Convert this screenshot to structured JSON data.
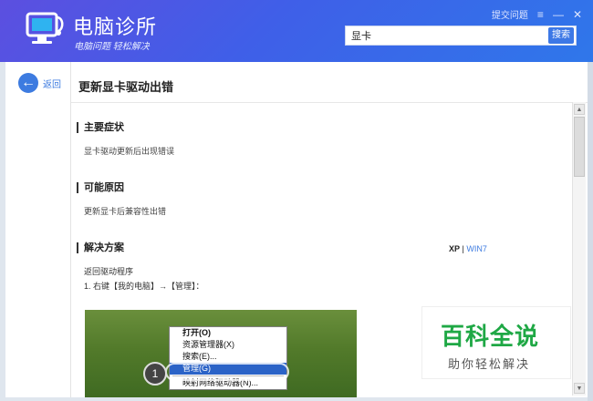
{
  "header": {
    "app_title": "电脑诊所",
    "app_subtitle": "电脑问题 轻松解决",
    "feedback_label": "提交问题",
    "menu_icon": "≡",
    "minimize_icon": "—",
    "close_icon": "✕",
    "search": {
      "value": "显卡",
      "button_label": "搜索"
    }
  },
  "page": {
    "back_label": "返回",
    "title": "更新显卡驱动出错"
  },
  "sections": {
    "symptoms": {
      "title": "主要症状",
      "body": "显卡驱动更新后出现错误"
    },
    "causes": {
      "title": "可能原因",
      "body": "更新显卡后兼容性出错"
    },
    "solution": {
      "title": "解决方案",
      "os_xp": "XP",
      "os_sep": "|",
      "os_win7": "WIN7",
      "step_title": "返回驱动程序",
      "step_1": "1. 右键【我的电脑】→【管理】："
    }
  },
  "screenshot_menu": {
    "items": [
      "打开(O)",
      "资源管理器(X)",
      "搜索(E)...",
      "管理(G)",
      "映射网络驱动器(N)..."
    ],
    "marker": "1"
  },
  "watermark": {
    "title": "百科全说",
    "subtitle": "助你轻松解决"
  },
  "colors": {
    "accent": "#3d7be0",
    "header_start": "#5c4fe0",
    "header_end": "#2f77ea",
    "watermark_green": "#1fa845"
  }
}
